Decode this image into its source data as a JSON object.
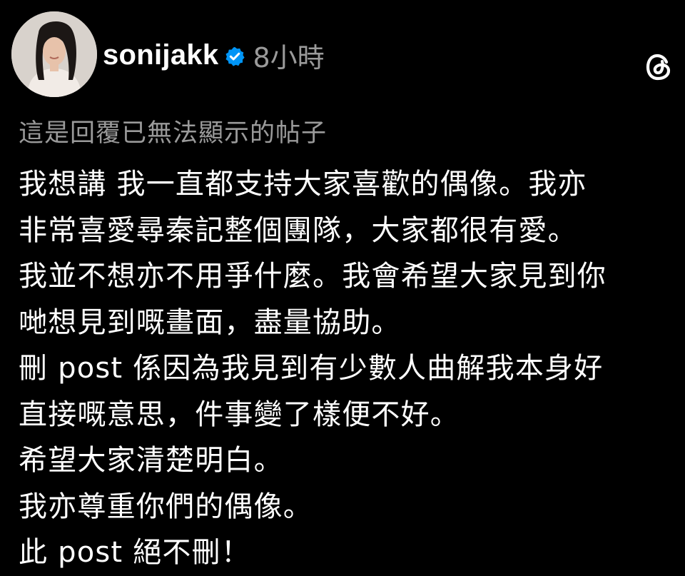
{
  "header": {
    "username": "sonijakk",
    "time_ago": "8小時"
  },
  "post": {
    "reply_note": "這是回覆已無法顯示的帖子",
    "lines": [
      "我想講 我一直都支持大家喜歡的偶像。我亦",
      "非常喜愛尋秦記整個團隊，大家都很有愛。",
      "我並不想亦不用爭什麼。我會希望大家見到你",
      "哋想見到嘅畫面，盡量協助。",
      "刪 post 係因為我見到有少數人曲解我本身好",
      "直接嘅意思，件事變了樣便不好。",
      "希望大家清楚明白。",
      "我亦尊重你們的偶像。",
      "此 post 絕不刪！"
    ]
  },
  "colors": {
    "background": "#000000",
    "text_primary": "#ffffff",
    "text_secondary": "#9a9a9a",
    "verified_badge": "#0095f6"
  },
  "icons": {
    "verified": "verified-badge-icon",
    "app": "threads-logo-icon"
  }
}
